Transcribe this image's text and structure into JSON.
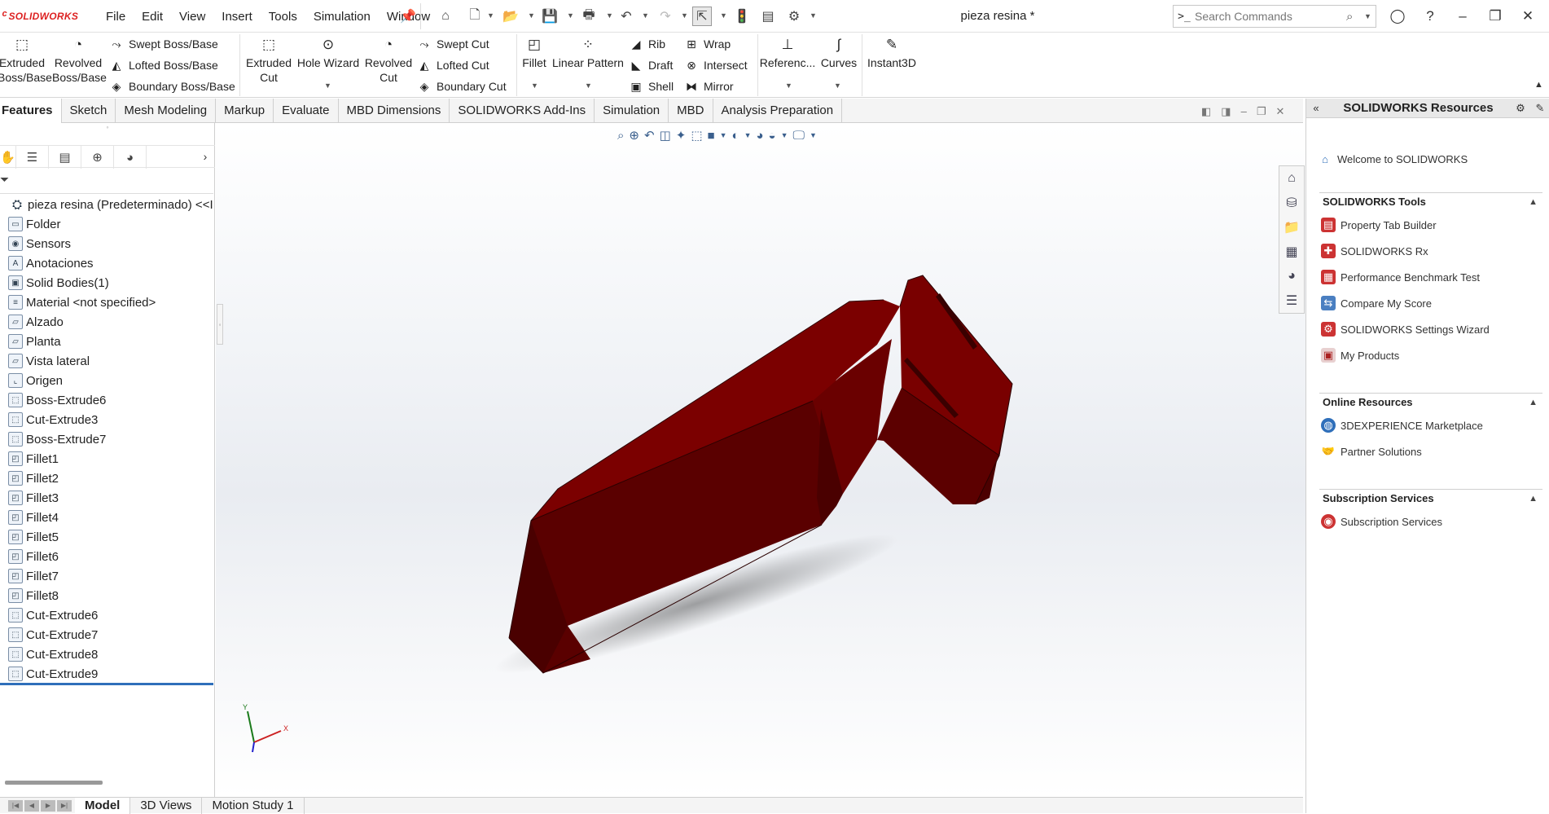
{
  "app": {
    "logo_text": "SOLIDWORKS",
    "document_title": "pieza resina *"
  },
  "menu": [
    "File",
    "Edit",
    "View",
    "Insert",
    "Tools",
    "Simulation",
    "Window"
  ],
  "search": {
    "placeholder": "Search Commands"
  },
  "ribbon": {
    "extruded_boss": "Extruded Boss/Base",
    "revolved_boss": "Revolved Boss/Base",
    "swept_boss": "Swept Boss/Base",
    "lofted_boss": "Lofted Boss/Base",
    "boundary_boss": "Boundary Boss/Base",
    "extruded_cut": "Extruded Cut",
    "hole_wizard": "Hole Wizard",
    "revolved_cut": "Revolved Cut",
    "swept_cut": "Swept Cut",
    "lofted_cut": "Lofted Cut",
    "boundary_cut": "Boundary Cut",
    "fillet": "Fillet",
    "linear_pattern": "Linear Pattern",
    "rib": "Rib",
    "draft": "Draft",
    "shell": "Shell",
    "wrap": "Wrap",
    "intersect": "Intersect",
    "mirror": "Mirror",
    "reference": "Referenc...",
    "curves": "Curves",
    "instant3d": "Instant3D"
  },
  "tabs": [
    "Features",
    "Sketch",
    "Mesh Modeling",
    "Markup",
    "Evaluate",
    "MBD Dimensions",
    "SOLIDWORKS Add-Ins",
    "Simulation",
    "MBD",
    "Analysis Preparation"
  ],
  "tree": {
    "root": "pieza resina (Predeterminado) <<I",
    "items": [
      "Folder",
      "Sensors",
      "Anotaciones",
      "Solid Bodies(1)",
      "Material <not specified>",
      "Alzado",
      "Planta",
      "Vista lateral",
      "Origen",
      "Boss-Extrude6",
      "Cut-Extrude3",
      "Boss-Extrude7",
      "Fillet1",
      "Fillet2",
      "Fillet3",
      "Fillet4",
      "Fillet5",
      "Fillet6",
      "Fillet7",
      "Fillet8",
      "Cut-Extrude6",
      "Cut-Extrude7",
      "Cut-Extrude8",
      "Cut-Extrude9"
    ]
  },
  "bottom_tabs": [
    "Model",
    "3D Views",
    "Motion Study 1"
  ],
  "triad": {
    "y": "Y",
    "x": "X"
  },
  "resources": {
    "title": "SOLIDWORKS Resources",
    "welcome": "Welcome to SOLIDWORKS",
    "tools_header": "SOLIDWORKS Tools",
    "tools": [
      "Property Tab Builder",
      "SOLIDWORKS Rx",
      "Performance Benchmark Test",
      "Compare My Score",
      "SOLIDWORKS Settings Wizard",
      "My Products"
    ],
    "online_header": "Online Resources",
    "online": [
      "3DEXPERIENCE Marketplace",
      "Partner Solutions"
    ],
    "subs_header": "Subscription Services",
    "subs": [
      "Subscription Services"
    ]
  },
  "colors": {
    "part": "#7a0000",
    "accent": "#2f6fba",
    "brand": "#d22222"
  }
}
